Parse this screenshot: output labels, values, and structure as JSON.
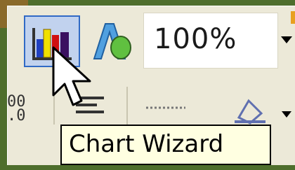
{
  "toolbar": {
    "chart_wizard_button": {
      "icon": "chart-wizard-icon",
      "state": "hovered"
    },
    "wordart_button": {
      "icon": "wordart-icon"
    },
    "zoom": {
      "value": "100%"
    },
    "decimal_icon_text": "00\n.0"
  },
  "tooltip": {
    "text": "Chart Wizard"
  },
  "colors": {
    "toolbar_bg": "#ece9d8",
    "hover_bg": "#c1d2ee",
    "hover_border": "#316ac5",
    "tooltip_bg": "#ffffe1",
    "frame": "#4e6e2c"
  }
}
